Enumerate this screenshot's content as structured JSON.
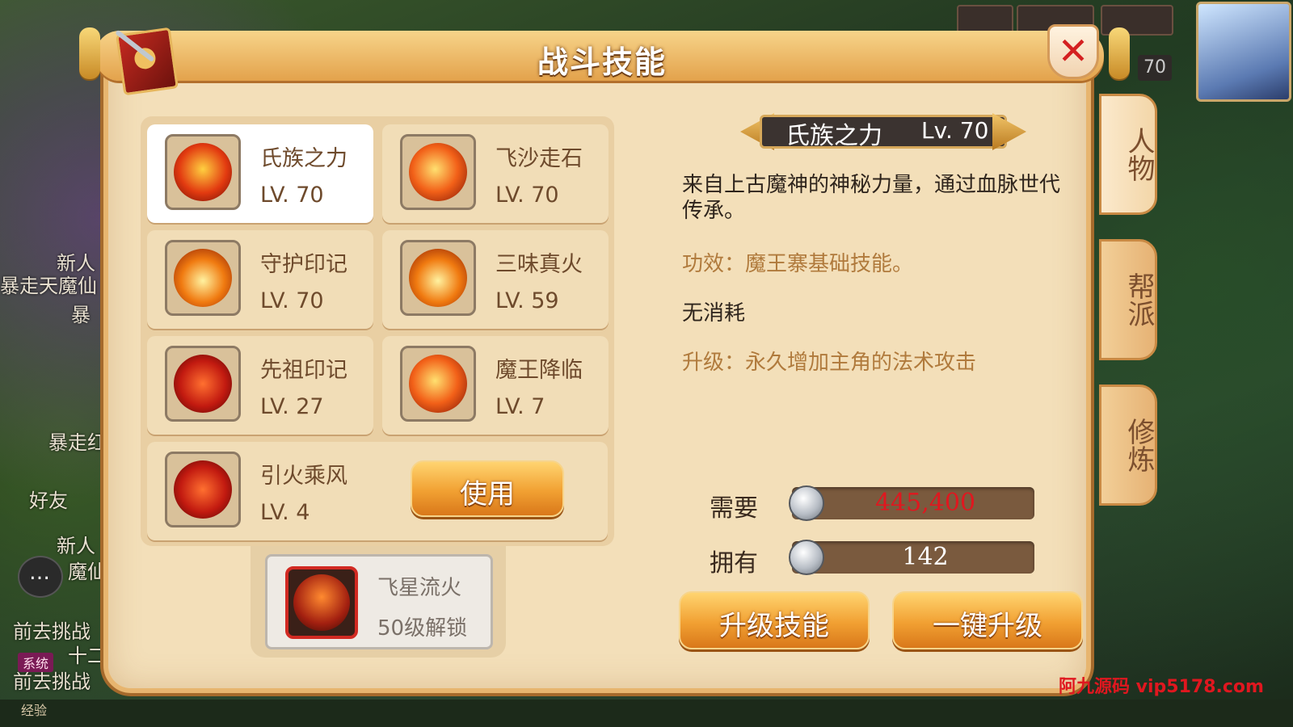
{
  "title": "战斗技能",
  "skills": [
    {
      "name": "氏族之力",
      "level": "LV. 70",
      "selected": true
    },
    {
      "name": "飞沙走石",
      "level": "LV. 70"
    },
    {
      "name": "守护印记",
      "level": "LV. 70"
    },
    {
      "name": "三味真火",
      "level": "LV. 59"
    },
    {
      "name": "先祖印记",
      "level": "LV. 27"
    },
    {
      "name": "魔王降临",
      "level": "LV. 7"
    },
    {
      "name": "引火乘风",
      "level": "LV. 4"
    }
  ],
  "use_button": "使用",
  "locked_skill": {
    "name": "飞星流火",
    "requirement": "50级解锁"
  },
  "detail": {
    "name": "氏族之力",
    "level": "Lv. 70",
    "description": "来自上古魔神的神秘力量，通过血脉世代传承。",
    "effect": "功效：魔王寨基础技能。",
    "cost": "无消耗",
    "upgrade": "升级：永久增加主角的法术攻击"
  },
  "resources": {
    "need_label": "需要",
    "need_value": "445,400",
    "own_label": "拥有",
    "own_value": "142"
  },
  "buttons": {
    "upgrade": "升级技能",
    "upgrade_all": "一键升级"
  },
  "tabs": [
    "人物",
    "帮派",
    "修炼"
  ],
  "hud": {
    "level": "70"
  },
  "side_chat": {
    "lines": [
      "新人",
      "暴走天魔仙",
      "暴",
      "暴走红",
      "好友",
      "新人",
      "魔仙",
      "前去挑战",
      "十二",
      "前去挑战"
    ],
    "system_badge": "系统",
    "exp_label": "经验"
  },
  "watermark": "阿九源码 vip5178.com",
  "colors": {
    "panel": "#f3dfb9",
    "accent_orange": "#f1a032",
    "need_red": "#e0171f"
  },
  "icons": [
    "book-icon",
    "close-icon",
    "coin-icon",
    "chat-icon"
  ]
}
